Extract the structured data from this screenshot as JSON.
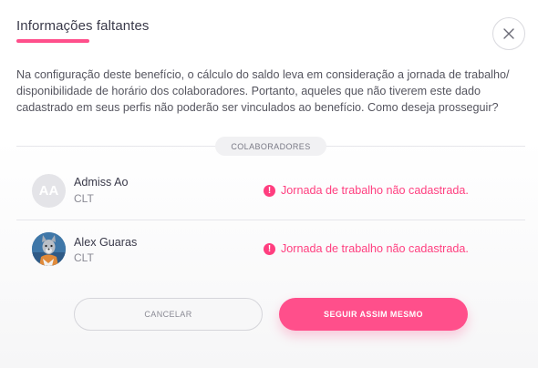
{
  "modal": {
    "title": "Informações faltantes",
    "description": "Na configuração deste benefício, o cálculo do saldo leva em consideração a jornada de trabalho/ disponibilidade de horário dos colaboradores. Portanto, aqueles que não tiverem este dado cadastrado em seus perfis não poderão ser vinculados ao benefício. Como deseja prosseguir?",
    "close_icon": "close-icon",
    "accent_color": "#ff4f8b"
  },
  "section": {
    "label": "COLABORADORES"
  },
  "employees": [
    {
      "initials": "AA",
      "name": "Admiss Ao",
      "role": "CLT",
      "warning": "Jornada de trabalho não cadastrada.",
      "warning_icon": "alert-icon"
    },
    {
      "avatar": "avatar-photo",
      "name": "Alex Guaras",
      "role": "CLT",
      "warning": "Jornada de trabalho não cadastrada.",
      "warning_icon": "alert-icon"
    }
  ],
  "actions": {
    "cancel_label": "CANCELAR",
    "continue_label": "SEGUIR ASSIM MESMO"
  }
}
